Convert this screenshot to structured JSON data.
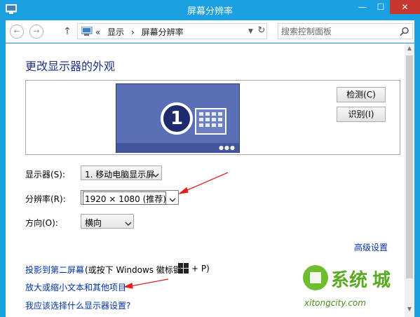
{
  "window": {
    "title": "屏幕分辨率",
    "controls": {
      "minimize": "—",
      "maximize": "☐",
      "close": "✕"
    },
    "accent": "#1ba1e2"
  },
  "addressbar": {
    "crumb_prefix": "«",
    "crumbs": [
      "显示",
      "屏幕分辨率"
    ],
    "separator": "›",
    "search_placeholder": "搜索控制面板"
  },
  "main": {
    "heading": "更改显示器的外观",
    "monitor_number": "1",
    "detect_button": "检测(C)",
    "identify_button": "识别(I)",
    "display_label": "显示器(S):",
    "display_value": "1. 移动电脑显示屏",
    "resolution_label": "分辨率(R):",
    "resolution_value": "1920 × 1080 (推荐)",
    "orientation_label": "方向(O):",
    "orientation_value": "横向",
    "advanced_link": "高级设置",
    "project_link": "投影到第二屏幕",
    "project_rest": "(或按下 Windows 徽标键",
    "project_suffix": "+ P)",
    "text_size_link": "放大或缩小文本和其他项目",
    "which_settings_link": "我应该选择什么显示器设置?"
  },
  "watermark": {
    "brand": "系统",
    "brand2": "城",
    "url": "xitongcity.com"
  },
  "colors": {
    "link": "#0033aa",
    "heading": "#1e3287",
    "annotation_arrow": "#e02020"
  }
}
